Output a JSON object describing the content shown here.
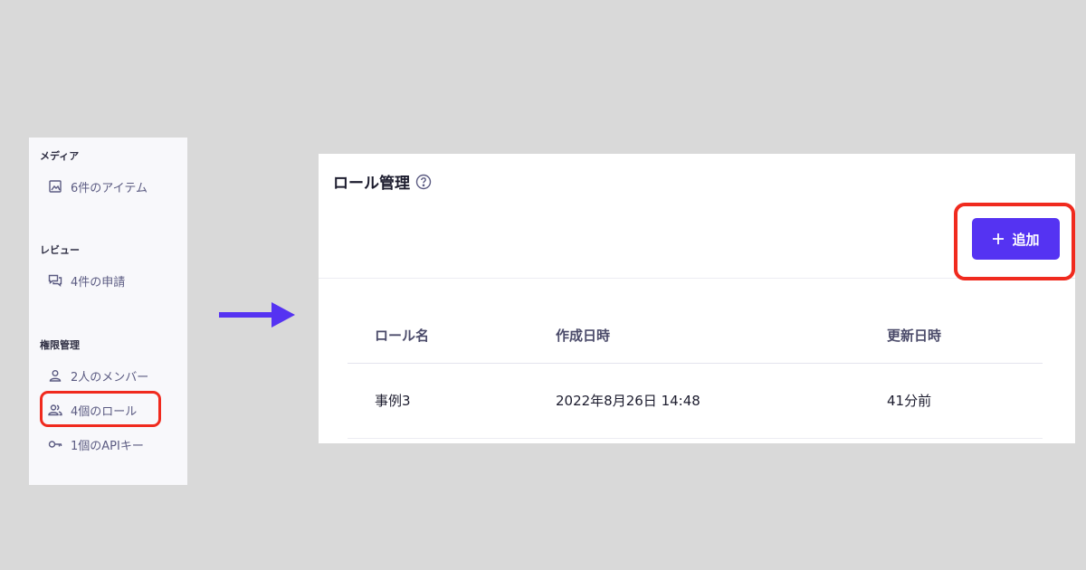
{
  "sidebar": {
    "sections": [
      {
        "title": "メディア",
        "items": [
          {
            "label": "6件のアイテム",
            "icon": "image-icon"
          }
        ]
      },
      {
        "title": "レビュー",
        "items": [
          {
            "label": "4件の申請",
            "icon": "comments-icon"
          }
        ]
      },
      {
        "title": "権限管理",
        "items": [
          {
            "label": "2人のメンバー",
            "icon": "user-icon"
          },
          {
            "label": "4個のロール",
            "icon": "users-icon"
          },
          {
            "label": "1個のAPIキー",
            "icon": "key-icon"
          }
        ]
      }
    ]
  },
  "main": {
    "title": "ロール管理",
    "add_button_label": "追加",
    "table": {
      "headers": [
        "ロール名",
        "作成日時",
        "更新日時"
      ],
      "rows": [
        [
          "事例3",
          "2022年8月26日 14:48",
          "41分前"
        ]
      ]
    }
  },
  "colors": {
    "accent": "#5533f2",
    "highlight": "#f02a1e",
    "arrow": "#5533f2"
  }
}
